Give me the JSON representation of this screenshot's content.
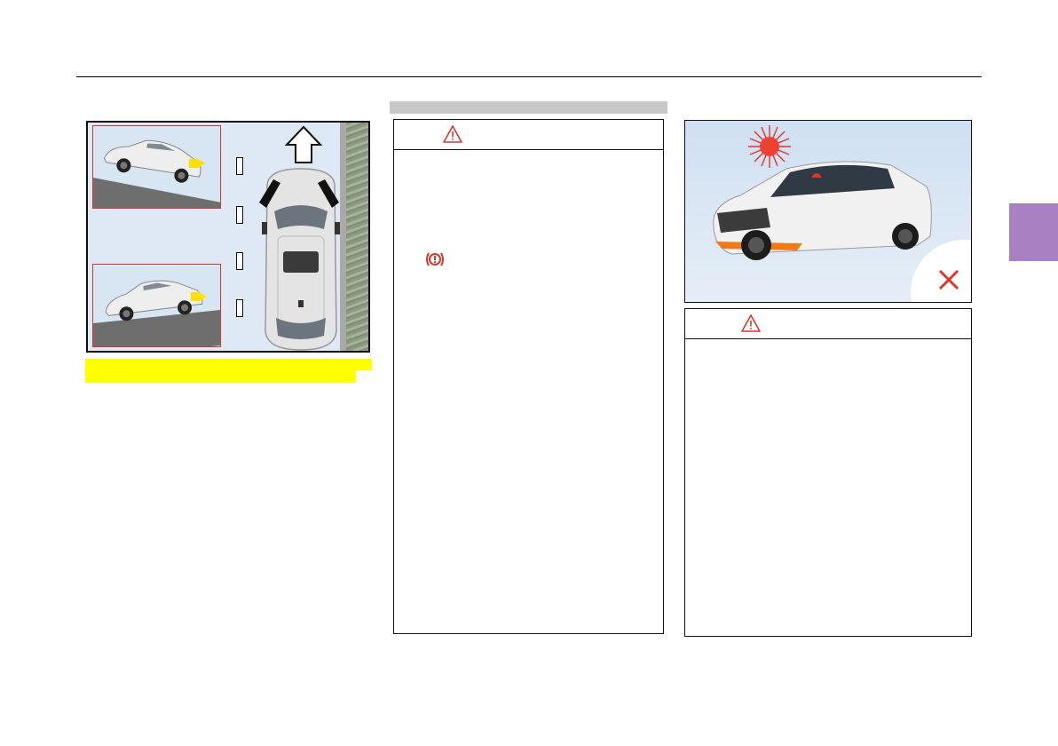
{
  "page": {
    "accent_color": "#a980c1",
    "highlight_color": "#ffff00",
    "warning_color": "#d7372f"
  },
  "left_figure": {
    "icons": [
      "car-uphill-image",
      "car-downhill-image",
      "up-arrow-icon",
      "parked-car-top-view-image"
    ]
  },
  "middle": {
    "warning_icon": "warning-triangle-icon",
    "brake_icon": "parking-brake-warning-icon"
  },
  "right": {
    "sun_icon": "sun-icon",
    "prohibited_icon": "prohibited-x-icon",
    "warning_icon": "warning-triangle-icon"
  }
}
